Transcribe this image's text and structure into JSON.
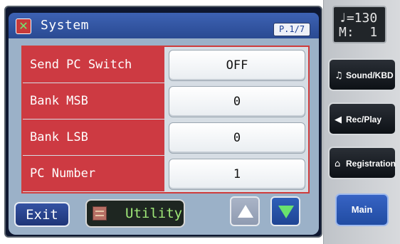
{
  "header": {
    "title": "System",
    "page": "P.1/7",
    "icon": "system-icon"
  },
  "rows": [
    {
      "label": "Send PC Switch",
      "value": "OFF"
    },
    {
      "label": "Bank MSB",
      "value": "0"
    },
    {
      "label": "Bank LSB",
      "value": "0"
    },
    {
      "label": "PC Number",
      "value": "1"
    }
  ],
  "bottom": {
    "exit": "Exit",
    "utility": "Utility",
    "up_icon": "up-arrow-icon",
    "down_icon": "down-arrow-icon"
  },
  "side": {
    "tempo_line1": "♩=130",
    "tempo_line2": "M:  1",
    "sound_kbd": "Sound/KBD",
    "rec_play": "Rec/Play",
    "registration": "Registration",
    "main": "Main",
    "sound_icon": "music-note-icon",
    "rec_icon": "speaker-icon",
    "reg_icon": "registration-icon"
  },
  "colors": {
    "header_blue": "#3257aa",
    "row_red": "#cd3a42",
    "panel_blue": "#9bb1c8",
    "accent_green": "#69e36d"
  }
}
